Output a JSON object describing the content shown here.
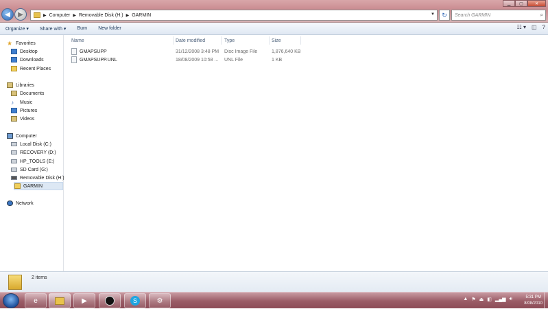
{
  "titlebar": {
    "breadcrumb": [
      "Computer",
      "Removable Disk (H:)",
      "GARMIN"
    ],
    "search_placeholder": "Search GARMIN"
  },
  "toolbar": {
    "organize": "Organize ▾",
    "share_with": "Share with ▾",
    "burn": "Burn",
    "new_folder": "New folder"
  },
  "nav": {
    "favorites": "Favorites",
    "desktop": "Desktop",
    "downloads": "Downloads",
    "recent_places": "Recent Places",
    "libraries": "Libraries",
    "documents": "Documents",
    "music": "Music",
    "pictures": "Pictures",
    "videos": "Videos",
    "computer": "Computer",
    "local_disk": "Local Disk (C:)",
    "recovery": "RECOVERY (D:)",
    "hp_tools": "HP_TOOLS (E:)",
    "sd_card": "SD Card (G:)",
    "removable": "Removable Disk (H:)",
    "garmin": "GARMIN",
    "network": "Network"
  },
  "columns": {
    "name": "Name",
    "date": "Date modified",
    "type": "Type",
    "size": "Size"
  },
  "files": [
    {
      "name": "GMAPSUPP",
      "date": "31/12/2008 3:48 PM",
      "type": "Disc Image File",
      "size": "1,876,640 KB"
    },
    {
      "name": "GMAPSUPP.UNL",
      "date": "18/08/2009 10:58 ...",
      "type": "UNL File",
      "size": "1 KB"
    }
  ],
  "status": {
    "count": "2 items"
  },
  "taskbar": {
    "time": "5:31 PM",
    "date": "8/08/2010"
  }
}
